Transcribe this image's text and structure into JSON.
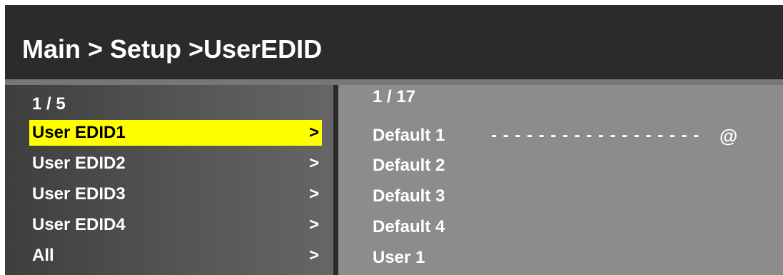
{
  "header": {
    "breadcrumb": "Main > Setup >UserEDID"
  },
  "left_menu": {
    "page_indicator": "1 / 5",
    "items": [
      {
        "label": "User EDID1",
        "arrow": ">",
        "selected": true
      },
      {
        "label": "User EDID2",
        "arrow": ">",
        "selected": false
      },
      {
        "label": "User EDID3",
        "arrow": ">",
        "selected": false
      },
      {
        "label": "User EDID4",
        "arrow": ">",
        "selected": false
      },
      {
        "label": "All",
        "arrow": ">",
        "selected": false
      }
    ]
  },
  "right_list": {
    "page_indicator": "1 / 17",
    "items": [
      {
        "label": "Default 1"
      },
      {
        "label": "Default 2"
      },
      {
        "label": "Default 3"
      },
      {
        "label": "Default 4"
      },
      {
        "label": "User 1"
      }
    ],
    "selection_dashes": "- - - - - - - - - - - - - - - - - -",
    "selection_marker": "@"
  },
  "colors": {
    "highlight": "#ffff00",
    "title_bg": "#2b2b2b",
    "right_panel_bg": "#8c8c8c"
  }
}
